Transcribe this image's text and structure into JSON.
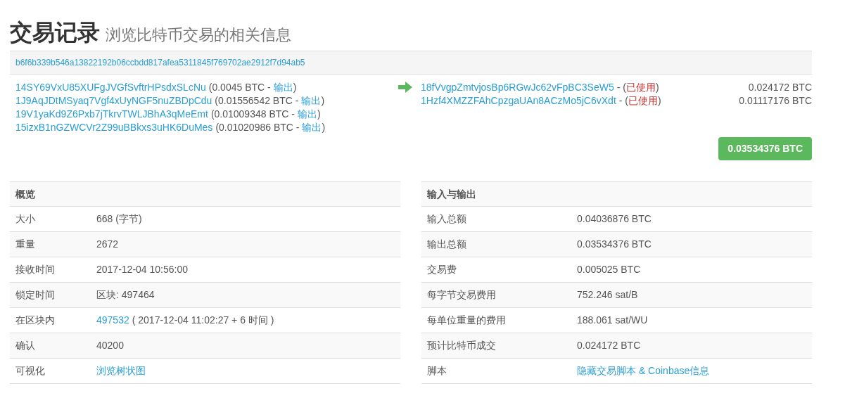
{
  "page": {
    "title": "交易记录",
    "subtitle": "浏览比特币交易的相关信息"
  },
  "transaction": {
    "hash": "b6f6b339b546a13822192b06ccbdd817afea5311845f769702ae2912f7d94ab5",
    "inputs": [
      {
        "address": "14SY69VxU85XUFgJVGfSvftrHPsdxSLcNu",
        "amount": "(0.0045 BTC -",
        "action": "输出",
        "close": ")"
      },
      {
        "address": "1J9AqJDtMSyaq7Vgf4xUyNGF5nuZBDpCdu",
        "amount": "(0.01556542 BTC -",
        "action": "输出",
        "close": ")"
      },
      {
        "address": "19V1yaKd9Z6Pxb7jTkrvTWLJBhA3qMeEmt",
        "amount": "(0.01009348 BTC -",
        "action": "输出",
        "close": ")"
      },
      {
        "address": "15izxB1nGZWCVr2Z99uBBkxs3uHK6DuMes",
        "amount": "(0.01020986 BTC -",
        "action": "输出",
        "close": ")"
      }
    ],
    "outputs": [
      {
        "address": "18fVvgpZmtvjosBp6RGwJc62vFpBC3SeW5",
        "separator": "- (",
        "status": "已使用",
        "close": ")",
        "spent": true,
        "value": "0.024172 BTC"
      },
      {
        "address": "1Hzf4XMZZFAhCpzgaUAn8ACzMo5jC6vXdt",
        "separator": "- (",
        "status": "已使用",
        "close": ")",
        "spent": true,
        "value": "0.01117176 BTC"
      }
    ],
    "total": "0.03534376 BTC"
  },
  "tables": [
    {
      "heading": "概览",
      "rows": [
        {
          "label": "大小",
          "value": "668 (字节)"
        },
        {
          "label": "重量",
          "value": "2672"
        },
        {
          "label": "接收时间",
          "value": "2017-12-04 10:56:00"
        },
        {
          "label": "锁定时间",
          "value": "区块: 497464"
        },
        {
          "label": "在区块内",
          "link": "497532",
          "value": "( 2017-12-04 11:02:27 + 6 时间 )"
        },
        {
          "label": "确认",
          "value": "40200"
        },
        {
          "label": "可视化",
          "link": "浏览树状图"
        }
      ]
    },
    {
      "heading": "输入与输出",
      "rows": [
        {
          "label": "输入总额",
          "value": "0.04036876 BTC"
        },
        {
          "label": "输出总额",
          "value": "0.03534376 BTC"
        },
        {
          "label": "交易费",
          "value": "0.005025 BTC"
        },
        {
          "label": "每字节交易费用",
          "value": "752.246 sat/B"
        },
        {
          "label": "每单位重量的费用",
          "value": "188.061 sat/WU"
        },
        {
          "label": "预计比特币成交",
          "value": "0.024172 BTC"
        },
        {
          "label": "脚本",
          "link": "隐藏交易脚本 & Coinbase信息"
        }
      ]
    }
  ]
}
